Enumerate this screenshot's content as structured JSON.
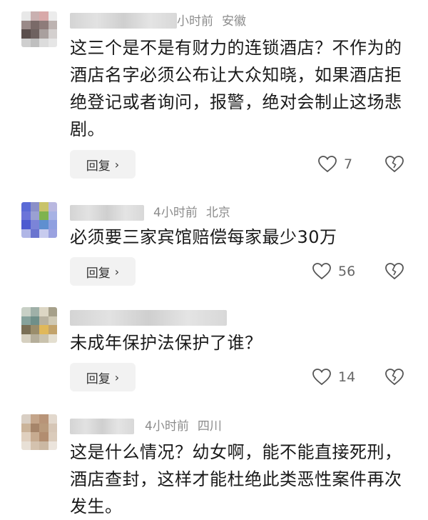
{
  "comments": [
    {
      "time": "小时前",
      "location": "安徽",
      "text": "这三个是不是有财力的连锁酒店？不作为的酒店名字必须公布让大众知晓，如果酒店拒绝登记或者询问，报警，绝对会制止这场悲剧。",
      "reply_label": "回复",
      "likes": "7",
      "avatar_colors": [
        "#e8e8e8",
        "#c9b0b0",
        "#d8a9a9",
        "#ececec",
        "#9a8a88",
        "#7a6a68",
        "#8e7c7a",
        "#bdb3b1",
        "#5a4e4c",
        "#6e6260",
        "#a9a09e",
        "#d4d0cf",
        "#cfcfcf",
        "#bfbfbf",
        "#dcdcdc",
        "#e6e6e6"
      ]
    },
    {
      "time": "4小时前",
      "location": "北京",
      "text": "必须要三家宾馆赔偿每家最少30万",
      "reply_label": "回复",
      "likes": "56",
      "avatar_colors": [
        "#5a6ad6",
        "#8a8fc8",
        "#c9c36a",
        "#b9b8e0",
        "#6b74d9",
        "#9aa0d2",
        "#7fb34f",
        "#a7b2e4",
        "#4d5bd0",
        "#7b84d8",
        "#5f8fd0",
        "#8fa0e0",
        "#b0b6e6",
        "#6a74cf",
        "#c7cbee",
        "#9aa2e0"
      ]
    },
    {
      "time": "",
      "location": "",
      "text": "未成年保护法保护了谁？",
      "reply_label": "回复",
      "likes": "14",
      "avatar_colors": [
        "#c8d0c6",
        "#9fb0a8",
        "#dcd6c4",
        "#a6a08a",
        "#86a29c",
        "#6f8f89",
        "#b8b2a0",
        "#cfc9b4",
        "#7a6f56",
        "#9a8d6b",
        "#e0b85a",
        "#c2a36b",
        "#d6d0c0",
        "#b5ae9a",
        "#c9c2ad",
        "#e4dfd0"
      ]
    },
    {
      "time": "4小时前",
      "location": "四川",
      "text": "这是什么情况？幼女啊，能不能直接死刑，酒店查封，这样才能杜绝此类恶性案件再次发生。",
      "reply_label": "回复",
      "likes": "",
      "avatar_colors": [
        "#d9cfc4",
        "#c4a58a",
        "#b89478",
        "#e2d8cd",
        "#cbb49a",
        "#a6856a",
        "#b99a7c",
        "#d6c6b6",
        "#e0d0bf",
        "#c7ab90",
        "#b28d70",
        "#dacbbb",
        "#e8e0d6",
        "#d4c2ae",
        "#cbb8a3",
        "#ebe4dc"
      ]
    }
  ]
}
